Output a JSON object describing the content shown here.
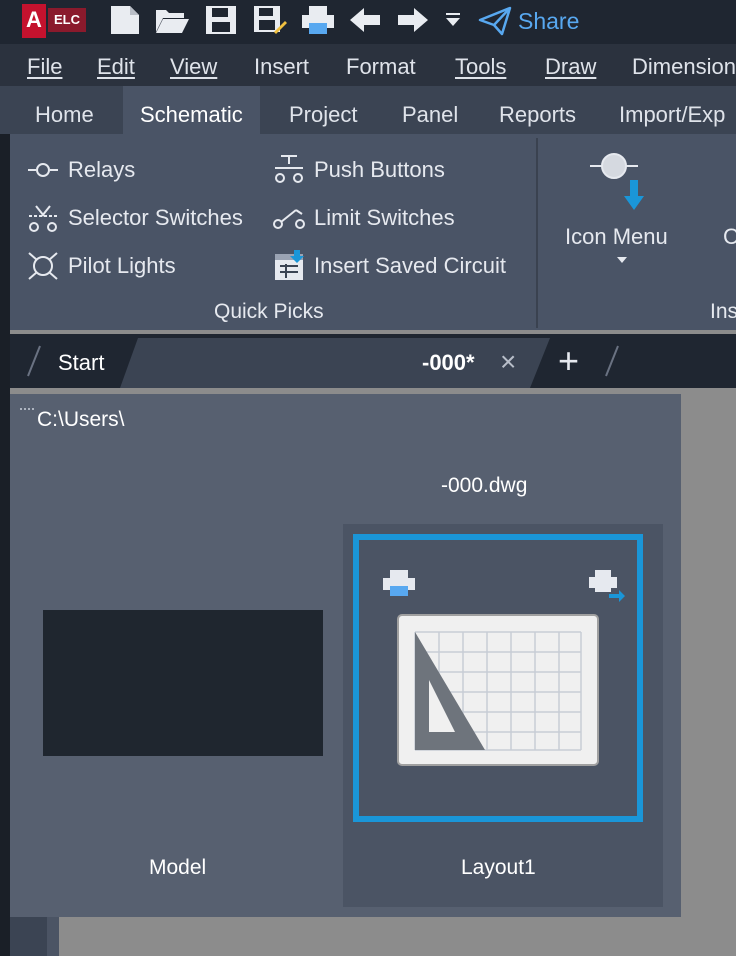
{
  "titlebar": {
    "app_badge": "A",
    "elc_badge": "ELC",
    "share_label": "Share"
  },
  "menubar": {
    "items": [
      "File",
      "Edit",
      "View",
      "Insert",
      "Format",
      "Tools",
      "Draw",
      "Dimension"
    ]
  },
  "ribbon_tabs": {
    "items": [
      "Home",
      "Schematic",
      "Project",
      "Panel",
      "Reports",
      "Import/Exp"
    ],
    "active": "Schematic"
  },
  "ribbon": {
    "quick_picks": {
      "relays": "Relays",
      "selector_switches": "Selector Switches",
      "pilot_lights": "Pilot Lights",
      "push_buttons": "Push Buttons",
      "limit_switches": "Limit Switches",
      "insert_saved_circuit": "Insert Saved Circuit",
      "panel_label": "Quick Picks"
    },
    "insert": {
      "icon_menu": "Icon Menu",
      "clipped_button": "C",
      "clipped_panel_label": "Ins"
    }
  },
  "doc_tabs": {
    "start": "Start",
    "current": "-000*",
    "close_glyph": "×",
    "add_glyph": "+"
  },
  "workspace": {
    "path": "C:\\Users\\",
    "filename": "-000.dwg",
    "model_label": "Model",
    "layout_label": "Layout1"
  },
  "colors": {
    "accent_blue": "#1a96d8",
    "share_blue": "#58a8f0",
    "brand_red": "#c4122e"
  }
}
